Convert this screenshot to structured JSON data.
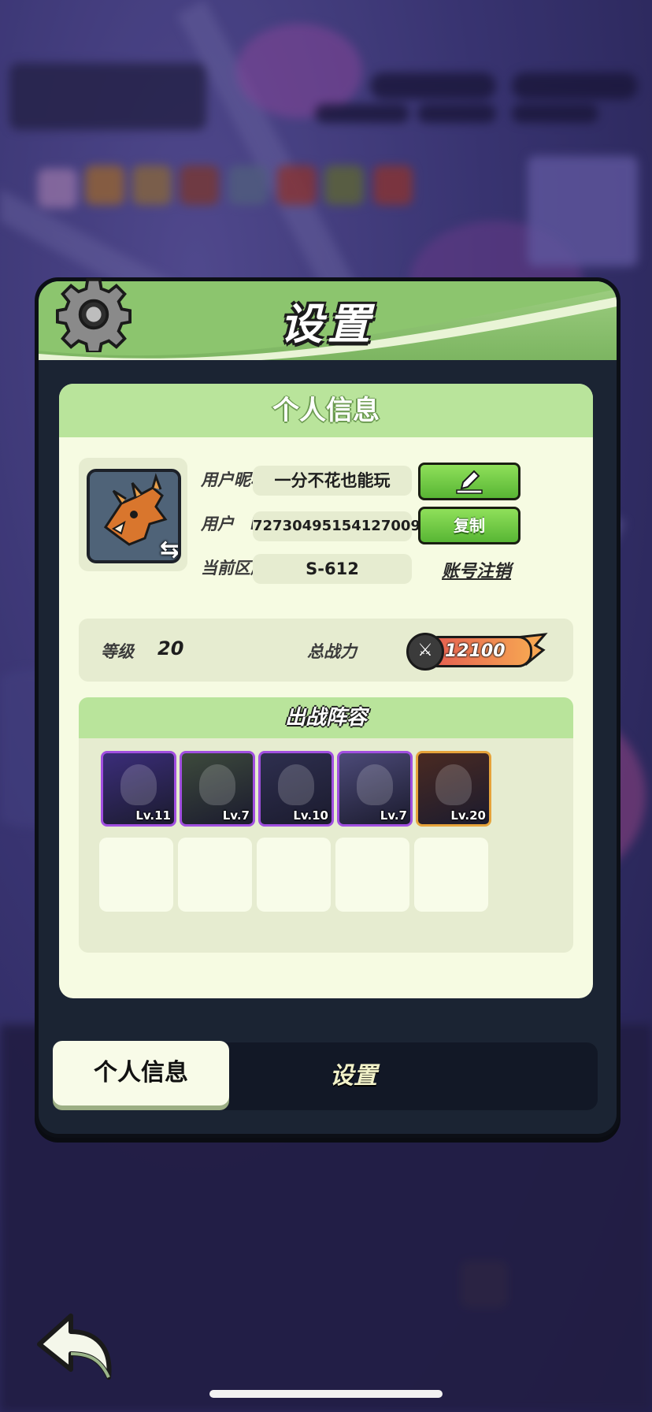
{
  "window": {
    "title": "设置"
  },
  "panel": {
    "title": "个人信息"
  },
  "profile": {
    "nickname_label": "用户昵称",
    "nickname": "一分不花也能玩",
    "id_label": "用户　ID",
    "user_id": "72730495154127009",
    "copy_label": "复制",
    "server_label": "当前区服",
    "server": "S-612",
    "delete_account_label": "账号注销"
  },
  "stats": {
    "level_label": "等级",
    "level": "20",
    "power_label": "总战力",
    "power": "12100"
  },
  "lineup": {
    "title": "出战阵容",
    "heroes": [
      {
        "level": "Lv.11",
        "rarity": "purple",
        "color": "#3b2d7a"
      },
      {
        "level": "Lv.7",
        "rarity": "purple",
        "color": "#3d4a3c"
      },
      {
        "level": "Lv.10",
        "rarity": "purple",
        "color": "#2e2f4f"
      },
      {
        "level": "Lv.7",
        "rarity": "purple",
        "color": "#4c4a78"
      },
      {
        "level": "Lv.20",
        "rarity": "gold",
        "color": "#4a2a22"
      }
    ],
    "empty_slots": 5
  },
  "tabs": [
    {
      "label": "个人信息",
      "active": true
    },
    {
      "label": "设置",
      "active": false
    }
  ],
  "icons": {
    "gear": "gear-icon",
    "edit": "pencil-icon",
    "swap": "swap-icon",
    "power": "crossed-swords-icon",
    "back": "back-arrow-icon"
  },
  "colors": {
    "header_green": "#8cc56e",
    "panel_bg": "#f6fbe2",
    "button_green": "#58b634",
    "modal_dark": "#1b2433"
  }
}
